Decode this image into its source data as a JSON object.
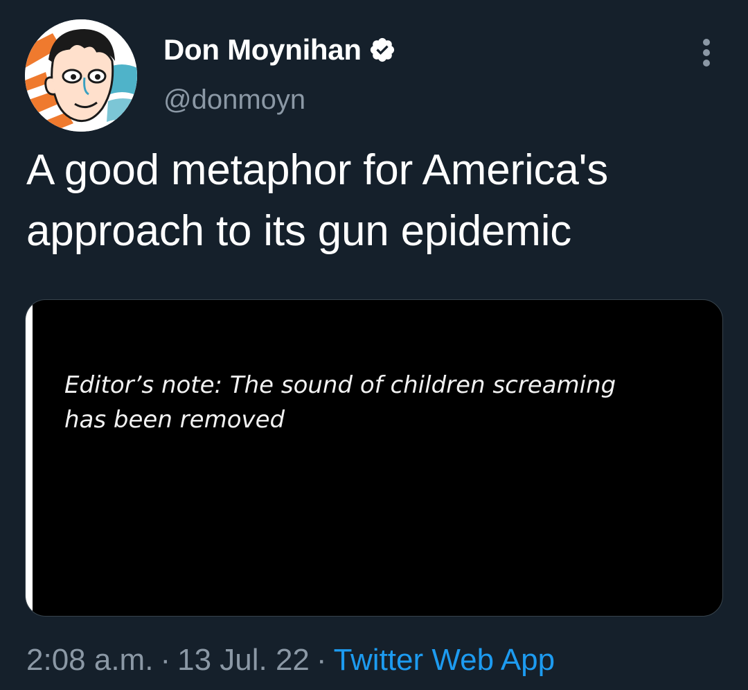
{
  "author": {
    "display_name": "Don Moynihan",
    "handle": "@donmoyn",
    "verified": true
  },
  "icons": {
    "avatar": "cartoon-face-avatar",
    "verified": "verified-badge-icon",
    "more": "more-dots-vertical-icon"
  },
  "tweet": {
    "text_line1": "A good metaphor for America's",
    "text_line2": "approach to its gun epidemic"
  },
  "media": {
    "caption_line1": "Editor’s note: The sound of children screaming",
    "caption_line2": "has been removed"
  },
  "meta": {
    "time": "2:08 a.m.",
    "separator": "·",
    "date": "13 Jul. 22",
    "source": "Twitter Web App"
  },
  "colors": {
    "background": "#15202b",
    "secondary_text": "#8b98a5",
    "link": "#1d9bf0"
  }
}
